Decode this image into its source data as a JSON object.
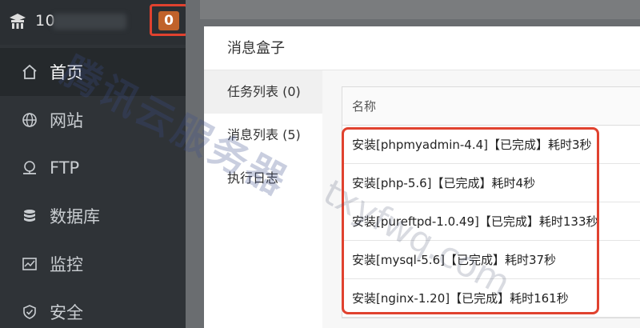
{
  "header": {
    "server_label": "10",
    "notification_count": "0"
  },
  "sidebar": {
    "items": [
      {
        "label": "首页",
        "icon": "home-icon",
        "active": true
      },
      {
        "label": "网站",
        "icon": "globe-icon",
        "active": false
      },
      {
        "label": "FTP",
        "icon": "ftp-icon",
        "active": false
      },
      {
        "label": "数据库",
        "icon": "database-icon",
        "active": false
      },
      {
        "label": "监控",
        "icon": "monitor-icon",
        "active": false
      },
      {
        "label": "安全",
        "icon": "shield-icon",
        "active": false
      }
    ]
  },
  "modal": {
    "title": "消息盒子",
    "tabs": [
      {
        "label": "任务列表 (0)",
        "active": true
      },
      {
        "label": "消息列表 (5)",
        "active": false
      },
      {
        "label": "执行日志",
        "active": false
      }
    ],
    "table": {
      "header": "名称",
      "rows": [
        "安装[phpmyadmin-4.4]【已完成】耗时3秒",
        "安装[php-5.6]【已完成】耗时4秒",
        "安装[pureftpd-1.0.49]【已完成】耗时133秒",
        "安装[mysql-5.6]【已完成】耗时37秒",
        "安装[nginx-1.20]【已完成】耗时161秒"
      ]
    }
  },
  "watermark": {
    "cn": "腾讯云服务器",
    "en": "txyfwq.com"
  },
  "colors": {
    "sidebar_bg": "#2f3337",
    "badge_bg": "#c0622a",
    "highlight_border": "#e0422f"
  }
}
